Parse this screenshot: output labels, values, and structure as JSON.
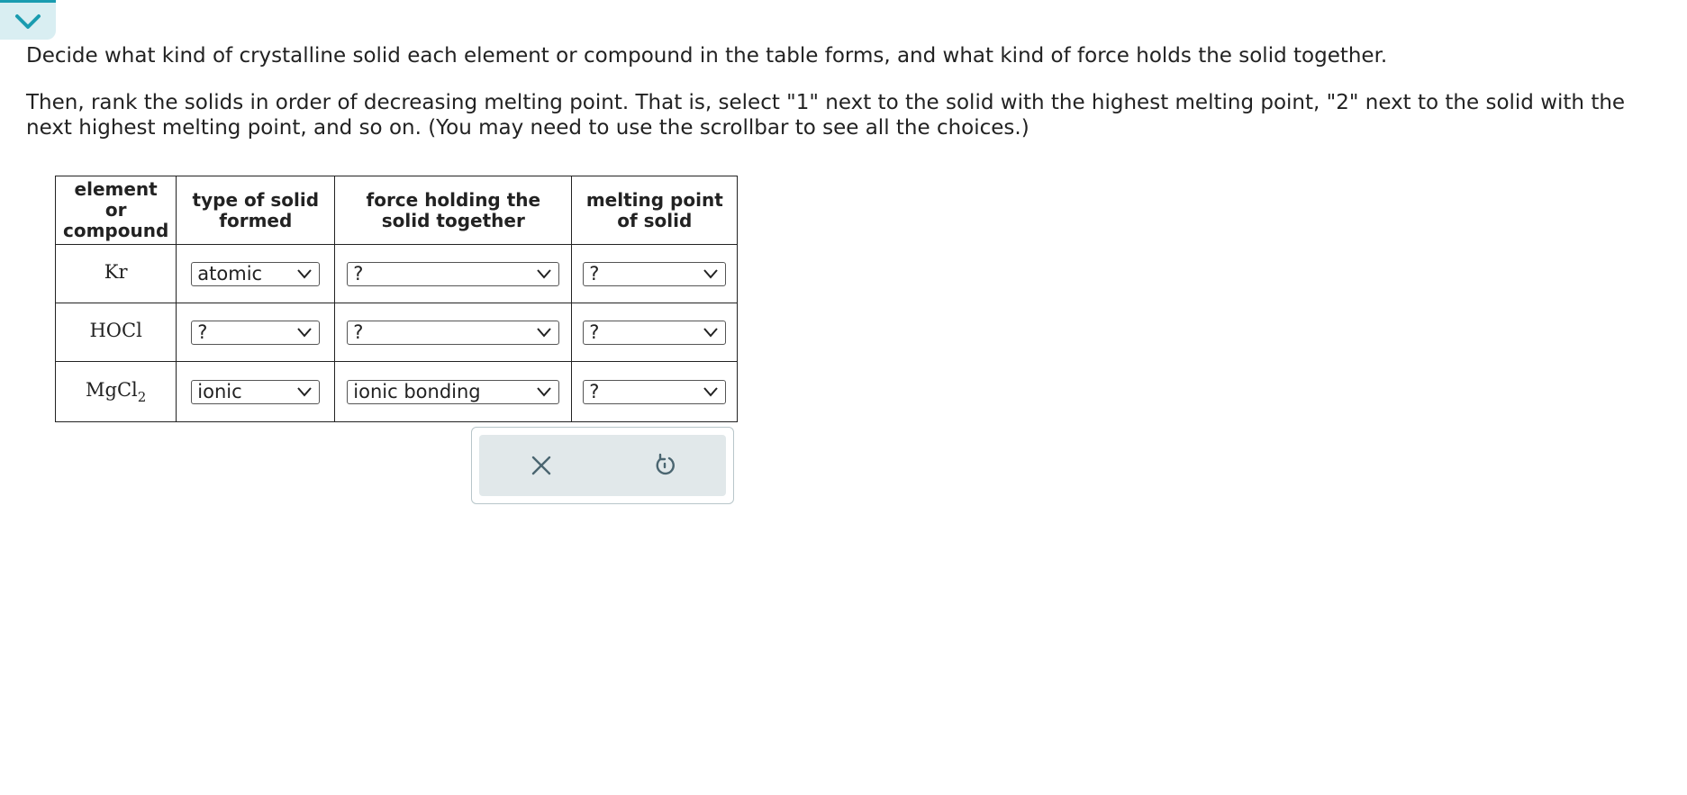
{
  "intro": {
    "line1": "Decide what kind of crystalline solid each element or compound in the table forms, and what kind of force holds the solid together.",
    "line2": "Then, rank the solids in order of decreasing melting point. That is, select \"1\" next to the solid with the highest melting point, \"2\" next to the solid with the next highest melting point, and so on. (You may need to use the scrollbar to see all the choices.)"
  },
  "table": {
    "headers": {
      "compound": "element or compound",
      "type": "type of solid formed",
      "force": "force holding the solid together",
      "melting": "melting point of solid"
    },
    "rows": [
      {
        "formula": "Kr",
        "formula_sub": "",
        "type": "atomic",
        "force": "?",
        "melting": "?"
      },
      {
        "formula": "HOCl",
        "formula_sub": "",
        "type": "?",
        "force": "?",
        "melting": "?"
      },
      {
        "formula": "MgCl",
        "formula_sub": "2",
        "type": "ionic",
        "force": "ionic bonding",
        "melting": "?"
      }
    ]
  },
  "icons": {
    "collapse": "chevron-down-icon",
    "clear": "close-icon",
    "reset": "undo-icon"
  },
  "colors": {
    "accent": "#1a9cb0",
    "tab_bg": "#d9eef2",
    "panel_bg": "#e1e8ea",
    "icon": "#4a6570"
  }
}
